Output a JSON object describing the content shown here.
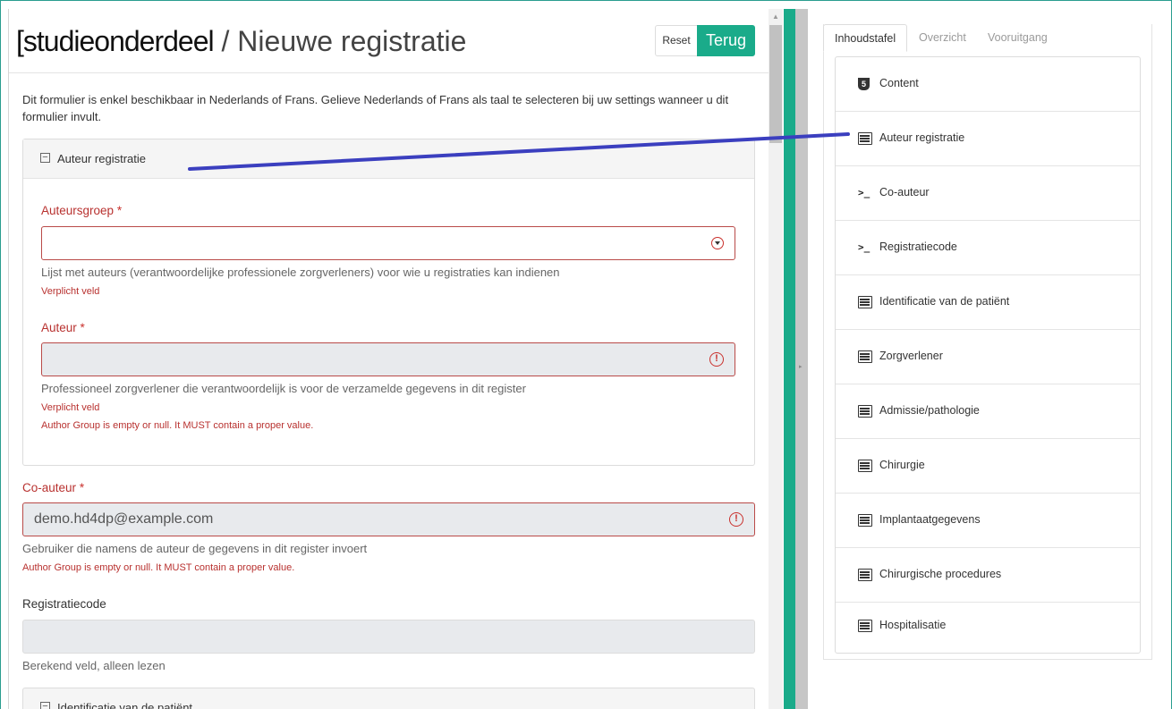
{
  "header": {
    "study_prefix": "[studieonderdeel",
    "title_rest": " / Nieuwe registratie",
    "reset_label": "Reset",
    "back_label": "Terug"
  },
  "intro": "Dit formulier is enkel beschikbaar in Nederlands of Frans. Gelieve Nederlands of Frans als taal te selecteren bij uw settings wanneer u dit formulier invult.",
  "section_author": {
    "title": "Auteur registratie",
    "group_label": "Auteursgroep",
    "group_help": "Lijst met auteurs (verantwoordelijke professionele zorgverleners) voor wie u registraties kan indienen",
    "group_error": "Verplicht veld",
    "author_label": "Auteur",
    "author_help": "Professioneel zorgverlener die verantwoordelijk is voor de verzamelde gegevens in dit register",
    "author_error1": "Verplicht veld",
    "author_error2": "Author Group is empty or null. It MUST contain a proper value."
  },
  "coauthor": {
    "label": "Co-auteur",
    "value": "demo.hd4dp@example.com",
    "help": "Gebruiker die namens de auteur de gegevens in dit register invoert",
    "error": "Author Group is empty or null. It MUST contain a proper value."
  },
  "regcode": {
    "label": "Registratiecode",
    "help": "Berekend veld, alleen lezen"
  },
  "required_mark": "*",
  "next_section": "Identificatie van de patiënt",
  "tabs": [
    "Inhoudstafel",
    "Overzicht",
    "Vooruitgang"
  ],
  "toc": [
    {
      "label": "Content",
      "icon": "html5-icon"
    },
    {
      "label": "Auteur registratie",
      "icon": "list-icon"
    },
    {
      "label": "Co-auteur",
      "icon": "terminal-icon"
    },
    {
      "label": "Registratiecode",
      "icon": "terminal-icon"
    },
    {
      "label": "Identificatie van de patiënt",
      "icon": "list-icon"
    },
    {
      "label": "Zorgverlener",
      "icon": "list-icon"
    },
    {
      "label": "Admissie/pathologie",
      "icon": "list-icon"
    },
    {
      "label": "Chirurgie",
      "icon": "list-icon"
    },
    {
      "label": "Implantaatgegevens",
      "icon": "list-icon"
    },
    {
      "label": "Chirurgische procedures",
      "icon": "list-icon"
    },
    {
      "label": "Hospitalisatie",
      "icon": "list-icon"
    }
  ],
  "colors": {
    "accent": "#1aab8a",
    "error": "#b8312f",
    "annotation_line": "#3b3fbf"
  }
}
